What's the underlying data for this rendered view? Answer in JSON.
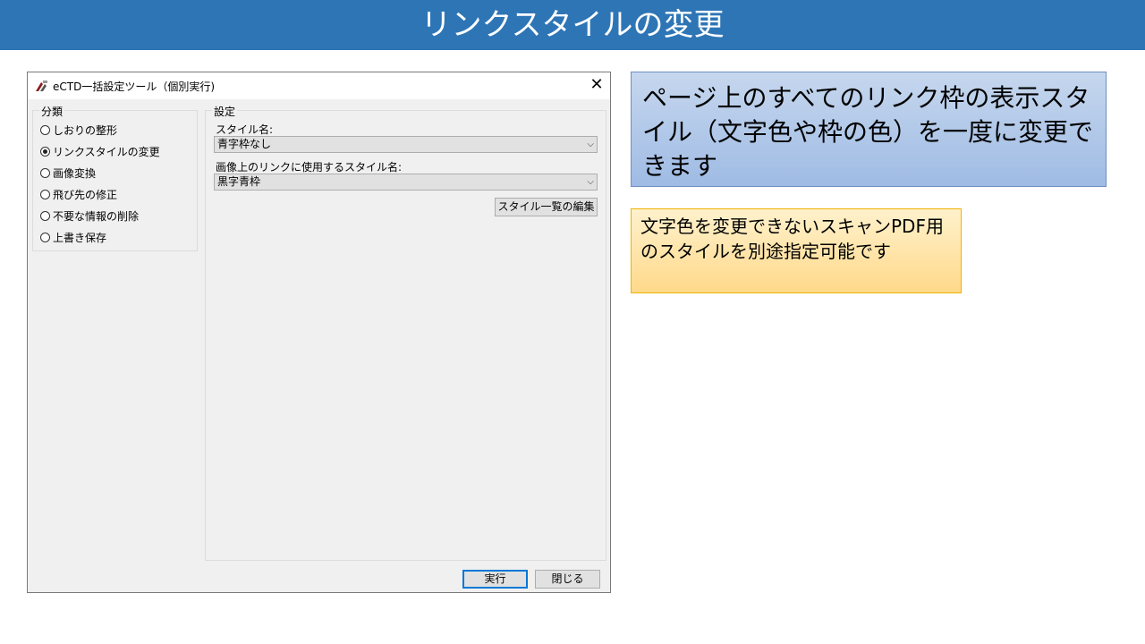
{
  "slide": {
    "title": "リンクスタイルの変更"
  },
  "dialog": {
    "title": "eCTD一括設定ツール（個別実行)",
    "close_label": "✕",
    "category": {
      "legend": "分類",
      "options": [
        {
          "label": "しおりの整形",
          "selected": false
        },
        {
          "label": "リンクスタイルの変更",
          "selected": true
        },
        {
          "label": "画像変換",
          "selected": false
        },
        {
          "label": "飛び先の修正",
          "selected": false
        },
        {
          "label": "不要な情報の削除",
          "selected": false
        },
        {
          "label": "上書き保存",
          "selected": false
        }
      ]
    },
    "settings": {
      "legend": "設定",
      "style_label": "スタイル名:",
      "style_value": "青字枠なし",
      "image_style_label": "画像上のリンクに使用するスタイル名:",
      "image_style_value": "黒字青枠",
      "edit_button": "スタイル一覧の編集"
    },
    "run_button": "実行",
    "close_button": "閉じる"
  },
  "callouts": {
    "main": "ページ上のすべてのリンク枠の表示スタイル（文字色や枠の色）を一度に変更できます",
    "note": "文字色を変更できないスキャンPDF用のスタイルを別途指定可能です"
  },
  "colors": {
    "title_bar": "#2e75b6",
    "default_button_border": "#0078d7"
  }
}
